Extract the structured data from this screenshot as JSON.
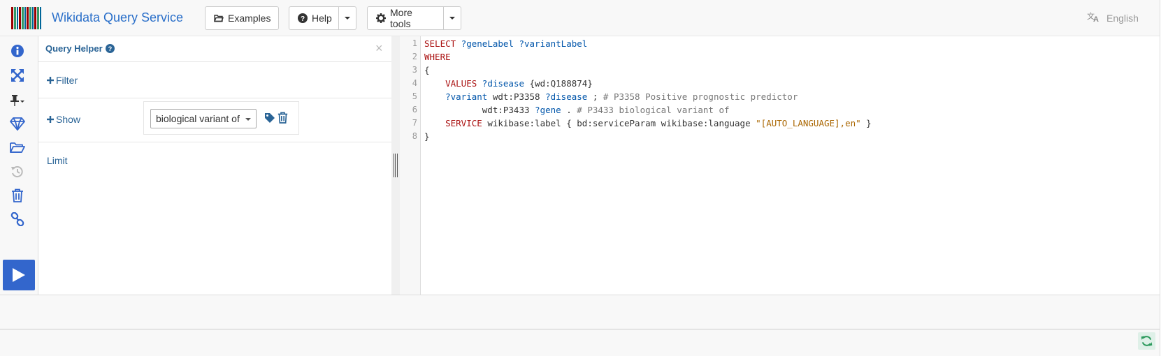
{
  "navbar": {
    "brand": "Wikidata Query Service",
    "logo_colors": [
      "#990000",
      "#339966",
      "#006699",
      "#990000",
      "#339966",
      "#006699",
      "#990000",
      "#339966",
      "#006699",
      "#990000",
      "#339966",
      "#006699"
    ],
    "examples_label": "Examples",
    "help_label": "Help",
    "more_tools_label": "More tools",
    "language_label": "English"
  },
  "sidebar": {
    "icons": [
      "info-icon",
      "expand-icon",
      "pin-icon",
      "gem-icon",
      "folder-open-icon",
      "history-icon",
      "trash-icon",
      "link-icon"
    ],
    "run_icon": "play-icon",
    "accent": "#3366cc"
  },
  "query_helper": {
    "title": "Query Helper",
    "filter_label": "Filter",
    "show_label": "Show",
    "show_value": "biological variant of",
    "limit_label": "Limit"
  },
  "editor": {
    "line_numbers": [
      "1",
      "2",
      "3",
      "4",
      "5",
      "6",
      "7",
      "8"
    ],
    "lines": [
      [
        {
          "t": "SELECT ",
          "c": "kw"
        },
        {
          "t": "?geneLabel ?variantLabel",
          "c": "var"
        }
      ],
      [
        {
          "t": "WHERE",
          "c": "kw"
        }
      ],
      [
        {
          "t": "{",
          "c": "pfx"
        }
      ],
      [
        {
          "t": "    ",
          "c": "pfx"
        },
        {
          "t": "VALUES ",
          "c": "kw"
        },
        {
          "t": "?disease ",
          "c": "var"
        },
        {
          "t": "{wd:Q188874}",
          "c": "pfx"
        }
      ],
      [
        {
          "t": "    ",
          "c": "pfx"
        },
        {
          "t": "?variant ",
          "c": "var"
        },
        {
          "t": "wdt:P3358 ",
          "c": "pfx"
        },
        {
          "t": "?disease ",
          "c": "var"
        },
        {
          "t": "; ",
          "c": "pfx"
        },
        {
          "t": "# P3358 Positive prognostic predictor",
          "c": "cm"
        }
      ],
      [
        {
          "t": "           wdt:P3433 ",
          "c": "pfx"
        },
        {
          "t": "?gene ",
          "c": "var"
        },
        {
          "t": ". ",
          "c": "pfx"
        },
        {
          "t": "# P3433 biological variant of",
          "c": "cm"
        }
      ],
      [
        {
          "t": "    ",
          "c": "pfx"
        },
        {
          "t": "SERVICE ",
          "c": "kw"
        },
        {
          "t": "wikibase:label { bd:serviceParam wikibase:language ",
          "c": "pfx"
        },
        {
          "t": "\"[AUTO_LANGUAGE],en\"",
          "c": "str"
        },
        {
          "t": " }",
          "c": "pfx"
        }
      ],
      [
        {
          "t": "}",
          "c": "pfx"
        }
      ]
    ]
  },
  "status": {
    "refresh_icon": "refresh-icon"
  }
}
